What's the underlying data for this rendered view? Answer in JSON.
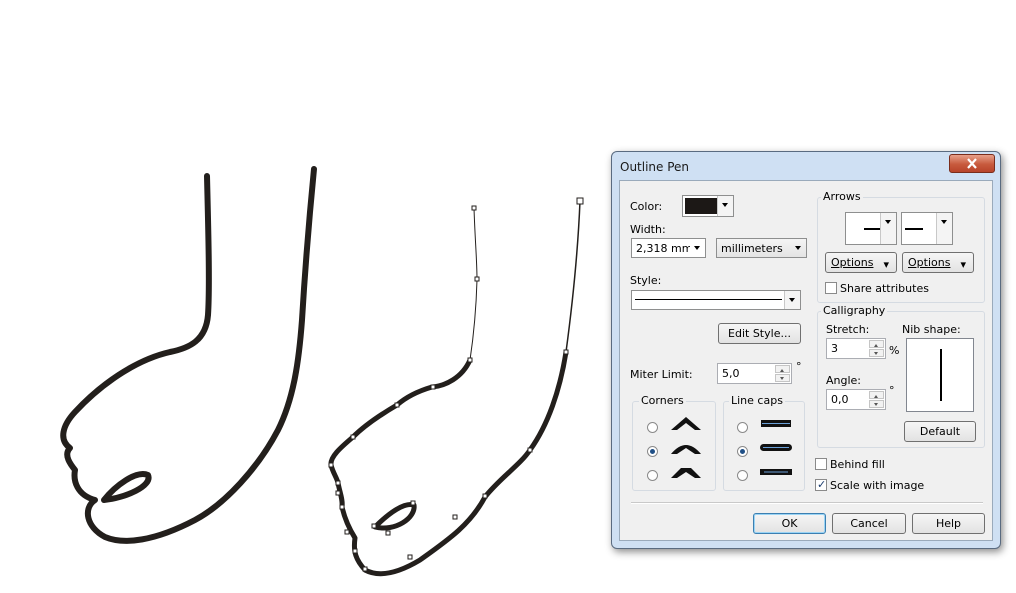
{
  "dialog": {
    "title": "Outline Pen",
    "color_label": "Color:",
    "color_value": "#1c1816",
    "width_label": "Width:",
    "width_value": "2,318 mm",
    "units_value": "millimeters",
    "style_label": "Style:",
    "edit_style_label": "Edit Style...",
    "miter_label": "Miter Limit:",
    "miter_value": "5,0",
    "degree_symbol": "°",
    "corners_label": "Corners",
    "linecaps_label": "Line caps",
    "corners_selected": 1,
    "linecaps_selected": 1,
    "arrows_label": "Arrows",
    "options_label": "Options",
    "share_label": "Share attributes",
    "share_checked": false,
    "calligraphy_label": "Calligraphy",
    "stretch_label": "Stretch:",
    "stretch_value": "3",
    "percent_symbol": "%",
    "nib_label": "Nib shape:",
    "angle_label": "Angle:",
    "angle_value": "0,0",
    "default_label": "Default",
    "behind_fill_label": "Behind fill",
    "behind_fill_checked": false,
    "scale_label": "Scale with image",
    "scale_checked": true,
    "ok_label": "OK",
    "cancel_label": "Cancel",
    "help_label": "Help"
  },
  "colors": {
    "stroke": "#231f1c",
    "dialog_frame": "#cfe0f3",
    "client": "#f0f0f0"
  }
}
